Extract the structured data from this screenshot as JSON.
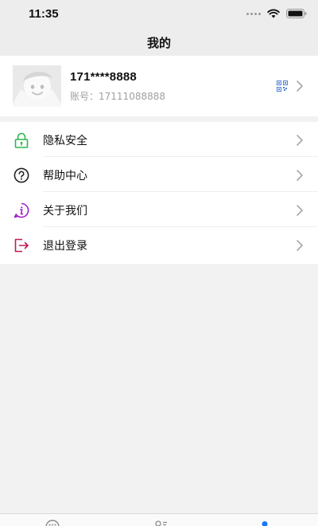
{
  "status_bar": {
    "time": "11:35"
  },
  "nav": {
    "title": "我的"
  },
  "profile": {
    "name": "171****8888",
    "account_label": "账号：",
    "account_value": "17111088888"
  },
  "menu": [
    {
      "label": "隐私安全",
      "icon": "lock-icon",
      "color": "#2db84d"
    },
    {
      "label": "帮助中心",
      "icon": "help-icon",
      "color": "#222222"
    },
    {
      "label": "关于我们",
      "icon": "info-icon",
      "color": "#a020c8"
    },
    {
      "label": "退出登录",
      "icon": "logout-icon",
      "color": "#c2185b"
    }
  ],
  "tab_bar": {
    "tabs": [
      {
        "icon": "chat-icon",
        "active": false
      },
      {
        "icon": "contacts-icon",
        "active": false
      },
      {
        "icon": "profile-icon",
        "active": true
      }
    ],
    "active_color": "#1677ff"
  }
}
